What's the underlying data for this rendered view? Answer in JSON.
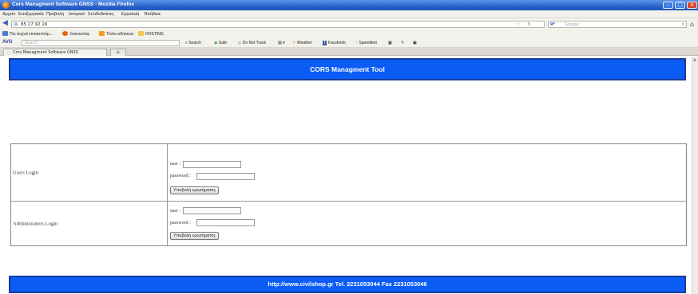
{
  "window": {
    "title": "Cors Managment Software GNSS - Mozilla Firefox",
    "minimize_glyph": "–",
    "maximize_glyph": "□",
    "close_glyph": "×"
  },
  "menu": [
    "Αρχείο",
    "Επεξεργασία",
    "Προβολή",
    "Ιστορικό",
    "Σελιδοδείκτες",
    "Εργαλεία",
    "Βοήθεια"
  ],
  "nav": {
    "url": "85.17.92.16",
    "search_engine": "Google",
    "back_glyph": "◀",
    "home_glyph": "⌂"
  },
  "bookmarks": [
    {
      "label": "Πιο συχνά επισκεπτόμ...",
      "color": "#4a7bd0"
    },
    {
      "label": "Ξεκινώντας",
      "color": "#e8620c"
    },
    {
      "label": "Τίτλοι ειδήσεων",
      "color": "#f0a020"
    },
    {
      "label": "HOSTING",
      "color": "#f2c94c"
    }
  ],
  "avg_toolbar": {
    "logo": "AVG",
    "search_placeholder": "Search",
    "search_button": "Search",
    "safe": "Safe",
    "do_not_track": "Do Not Track",
    "weather": "Weather",
    "facebook": "Facebook",
    "speedtest": "Speedtest"
  },
  "tab": {
    "label": "Cors Managment Software GNSS",
    "new_tab_glyph": "+"
  },
  "page": {
    "header": "CORS Managment Tool",
    "users_row": {
      "title": "Users Login",
      "user_label": "user :",
      "password_label": "password :",
      "submit": "Υποβολή ερωτήματος"
    },
    "admin_row": {
      "title": "Administrators Login",
      "user_label": "user :",
      "password_label": "password :",
      "submit": "Υποβολή ερωτήματος"
    },
    "footer": "http://www.civilshop.gr Tel. 2231053044 Fax 2231053046"
  },
  "colors": {
    "banner_blue": "#0a5cf5",
    "titlebar_blue": "#2a63c9"
  }
}
